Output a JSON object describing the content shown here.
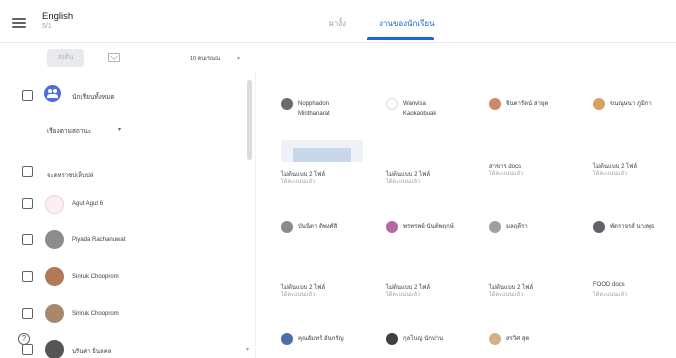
{
  "header": {
    "class_name": "English",
    "class_section": "5/1",
    "tab_left": "ผางั้ง",
    "tab_active": "งานของนักเรียน"
  },
  "toolbar": {
    "return_label": "ส่งคืน",
    "student_count": "10 คนเรณณ"
  },
  "sidebar": {
    "all_students_label": "นักเรียนทั้งหมด",
    "sort_label": "เรียงตามสถานะ",
    "rows": [
      {
        "name": "จะดหราชปเห็บปล่"
      },
      {
        "name": "Agut Agut 6"
      },
      {
        "name": "Piyada Rachanuwat"
      },
      {
        "name": "Siriruk Chooprom"
      },
      {
        "name": "Siriruk Chooprom"
      },
      {
        "name": "นรินศา ธิ่นลคล"
      }
    ]
  },
  "grid": {
    "cards": [
      {
        "name1": "Nopphadon",
        "name2": "Minthanarat",
        "sub": "ไม่ต้นแบบ 2 ไฟล์",
        "sub2": "ได้คะแนนแล้ว",
        "avatar": "#6b6b6b"
      },
      {
        "name1": "Wanvisa",
        "name2": "Kaokaobuak",
        "sub": "ไม่ต้นแบบ 2 ไฟล์",
        "sub2": "ได้คะแนนแล้ว",
        "avatar": "#ffffff"
      },
      {
        "name1": "จินดารัตน์ ล่ายุต",
        "name2": "",
        "sub": "สาขาร docs",
        "sub2": "ได้คะแนนแล้ว",
        "avatar": "#c98a6a"
      },
      {
        "name1": "ขนณุษนา ภูมิกา",
        "name2": "",
        "sub": "ไม่ต้นแบบ 2 ไฟล์",
        "sub2": "ได้คะแนนแล้ว",
        "avatar": "#d9a066"
      },
      {
        "name1": "บันนิตา ติพงศ์สิ",
        "name2": "",
        "sub": "ไม่ต้นแบบ 2 ไฟล์",
        "sub2": "ได้คะแนนแล้ว",
        "avatar": "#8a8a8a"
      },
      {
        "name1": "พรทรพย์ นันต์พฤกษ์",
        "name2": "",
        "sub": "ไม่ต้นแบบ 2 ไฟล์",
        "sub2": "ได้คะแนนแล้ว",
        "avatar": "#b36aa1"
      },
      {
        "name1": "มลฤดีรา",
        "name2": "",
        "sub": "ไม่ต้นแบบ 2 ไฟล์",
        "sub2": "ได้คะแนนแล้ว",
        "avatar": "#9aa0a6"
      },
      {
        "name1": "พัดราจรส์ นางพุธ",
        "name2": "",
        "sub": "FOOD docs",
        "sub2": "ได้คะแนนแล้ว",
        "avatar": "#5f6368"
      },
      {
        "name1": "คุณอัมทร์ อันกรัญ",
        "name2": "",
        "sub": "",
        "sub2": "",
        "avatar": "#4a6fa5"
      },
      {
        "name1": "กุลโบญ่ นักปาน",
        "name2": "",
        "sub": "",
        "sub2": "",
        "avatar": "#3c4043"
      },
      {
        "name1": "สรวิศ สุต",
        "name2": "",
        "sub": "",
        "sub2": "",
        "avatar": "#d4b08a"
      }
    ]
  }
}
